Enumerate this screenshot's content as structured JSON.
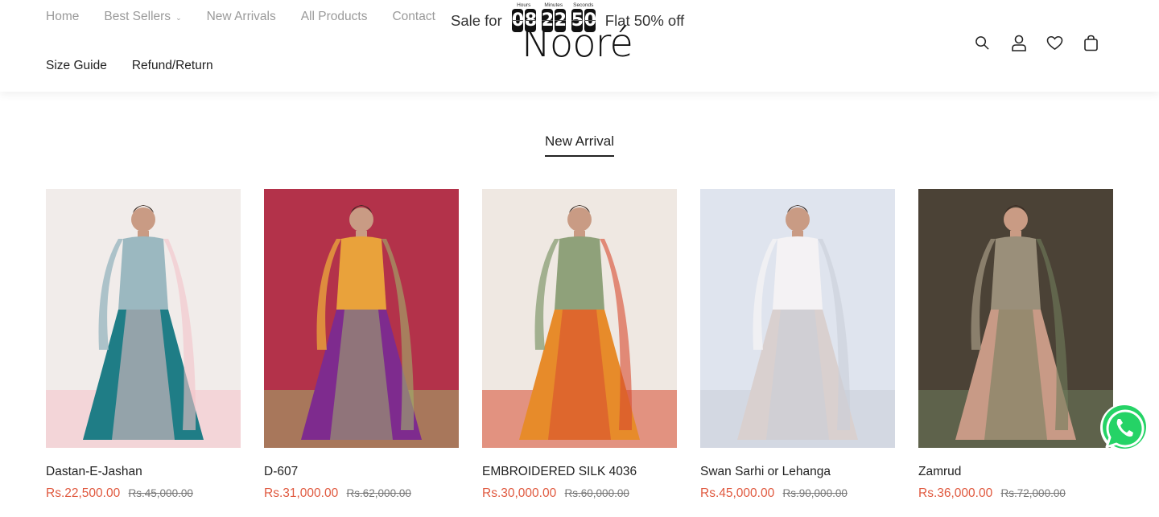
{
  "nav": {
    "top": [
      {
        "label": "Home"
      },
      {
        "label": "Best Sellers",
        "has_dropdown": true
      },
      {
        "label": "New Arrivals"
      },
      {
        "label": "All Products"
      },
      {
        "label": "Contact"
      }
    ],
    "bottom": [
      {
        "label": "Size Guide"
      },
      {
        "label": "Refund/Return"
      }
    ]
  },
  "logo": {
    "text": "Nooré"
  },
  "sale": {
    "prefix": "Sale for",
    "suffix": "Flat 50% off",
    "timer": {
      "hours_label": "Hours",
      "minutes_label": "Minutes",
      "seconds_label": "Seconds",
      "hours": [
        "0",
        "8"
      ],
      "minutes": [
        "2",
        "2"
      ],
      "seconds": [
        "5",
        "0"
      ]
    }
  },
  "icons": [
    "search-icon",
    "account-icon",
    "wishlist-heart-icon",
    "cart-bag-icon"
  ],
  "section": {
    "title": "New Arrival"
  },
  "products": [
    {
      "name": "Dastan-E-Jashan",
      "price": "Rs.22,500.00",
      "old_price": "Rs.45,000.00",
      "palette": [
        "#f1ecea",
        "#9bb8c0",
        "#1f7d86",
        "#f4c3c8"
      ]
    },
    {
      "name": "D-607",
      "price": "Rs.31,000.00",
      "old_price": "Rs.62,000.00",
      "palette": [
        "#b3324a",
        "#e9a23b",
        "#7e2b8e",
        "#9fb06a"
      ]
    },
    {
      "name": "EMBROIDERED SILK 4036",
      "price": "Rs.30,000.00",
      "old_price": "Rs.60,000.00",
      "palette": [
        "#efe8e2",
        "#8fa17a",
        "#e78b2a",
        "#d74a2f"
      ]
    },
    {
      "name": "Swan Sarhi or Lehanga",
      "price": "Rs.45,000.00",
      "old_price": "Rs.90,000.00",
      "palette": [
        "#dfe4ee",
        "#f4f2f4",
        "#d9d0cf",
        "#c9ced8"
      ]
    },
    {
      "name": "Zamrud",
      "price": "Rs.36,000.00",
      "old_price": "Rs.72,000.00",
      "palette": [
        "#4b4236",
        "#9a8f7a",
        "#c89a86",
        "#6f7d5c"
      ]
    }
  ],
  "whatsapp": {
    "icon": "whatsapp-icon",
    "color": "#25d366"
  }
}
